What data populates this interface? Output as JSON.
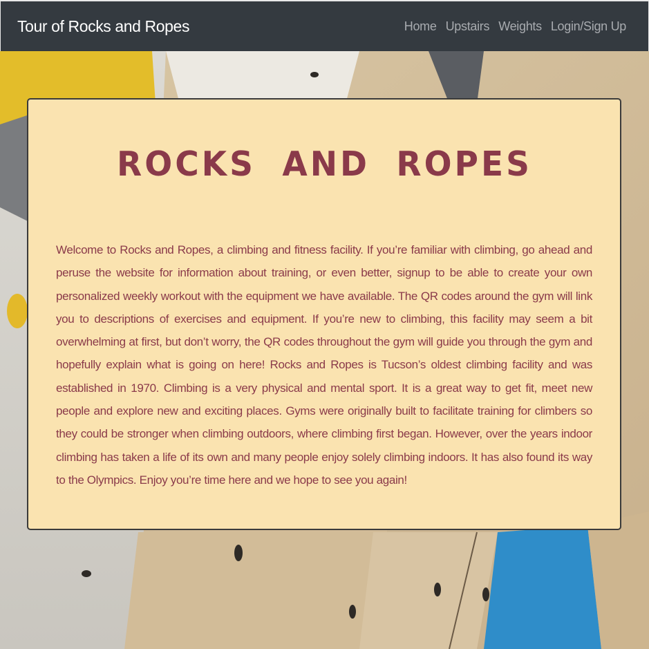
{
  "navbar": {
    "brand": "Tour of Rocks and Ropes",
    "links": [
      {
        "label": "Home"
      },
      {
        "label": "Upstairs"
      },
      {
        "label": "Weights"
      },
      {
        "label": "Login/Sign Up"
      }
    ]
  },
  "main": {
    "title": "ROCKS AND ROPES",
    "body": "Welcome to Rocks and Ropes, a climbing and fitness facility. If you’re familiar with climbing, go ahead and peruse the website for information about training, or even better, signup to be able to create your own personalized weekly workout with the equipment we have available. The QR codes around the gym will link you to descriptions of exercises and equipment. If you’re new to climbing, this facility may seem a bit overwhelming at first, but don’t worry, the QR codes throughout the gym will guide you through the gym and hopefully explain what is going on here! Rocks and Ropes is Tucson’s oldest climbing facility and was established in 1970. Climbing is a very physical and mental sport. It is a great way to get fit, meet new people and explore new and exciting places. Gyms were originally built to facilitate training for climbers so they could be stronger when climbing outdoors, where climbing first began. However, over the years indoor climbing has taken a life of its own and many people enjoy solely climbing indoors. It has also found its way to the Olympics. Enjoy you’re time here and we hope to see you again!"
  },
  "colors": {
    "navbar_bg": "#343a40",
    "nav_link": "#a8abaf",
    "brand_text": "#ffffff",
    "card_bg": "#fae3b0",
    "accent_text": "#8a3a4a"
  }
}
